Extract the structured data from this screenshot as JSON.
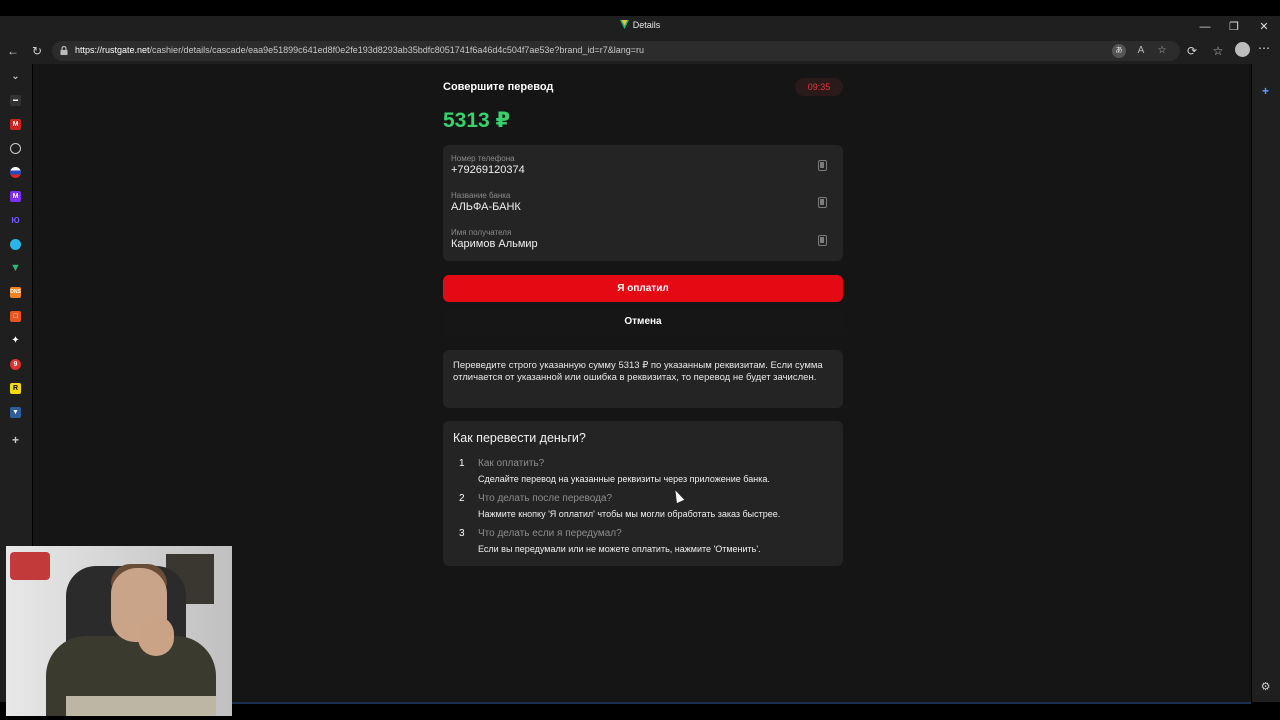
{
  "window": {
    "title": "Details",
    "minimize": "—",
    "maximize": "❐",
    "close": "✕"
  },
  "address_bar": {
    "url_domain": "https://rustgate.net",
    "url_path": "/cashier/details/cascade/eaa9e51899c641ed8f0e2fe193d8293ab35bdfc8051741f6a46d4c504f7ae53e?brand_id=r7&lang=ru"
  },
  "payment": {
    "headline": "Совершите перевод",
    "timer": "09:35",
    "amount": "5313 ₽",
    "fields": [
      {
        "label": "Номер телефона",
        "value": "+79269120374"
      },
      {
        "label": "Название банка",
        "value": "АЛЬФА-БАНК"
      },
      {
        "label": "Имя получателя",
        "value": "Каримов Альмир"
      }
    ],
    "pay_button": "Я оплатил",
    "cancel_button": "Отмена",
    "notice": "Переведите строго указанную сумму 5313 ₽ по указанным реквизитам. Если сумма отличается от указанной или ошибка в реквизитах, то перевод не будет зачислен."
  },
  "howto": {
    "title": "Как перевести деньги?",
    "steps": [
      {
        "num": "1",
        "question": "Как оплатить?",
        "answer": "Сделайте перевод на указанные реквизиты через приложение банка."
      },
      {
        "num": "2",
        "question": "Что делать после перевода?",
        "answer": "Нажмите кнопку 'Я оплатил' чтобы мы могли обработать заказ быстрее."
      },
      {
        "num": "3",
        "question": "Что делать если я передумал?",
        "answer": "Если вы передумали или не можете оплатить, нажмите 'Отменить'."
      }
    ]
  },
  "colors": {
    "accent_red": "#e50914",
    "amount_green": "#36d36d",
    "timer_red": "#e23a3a"
  }
}
